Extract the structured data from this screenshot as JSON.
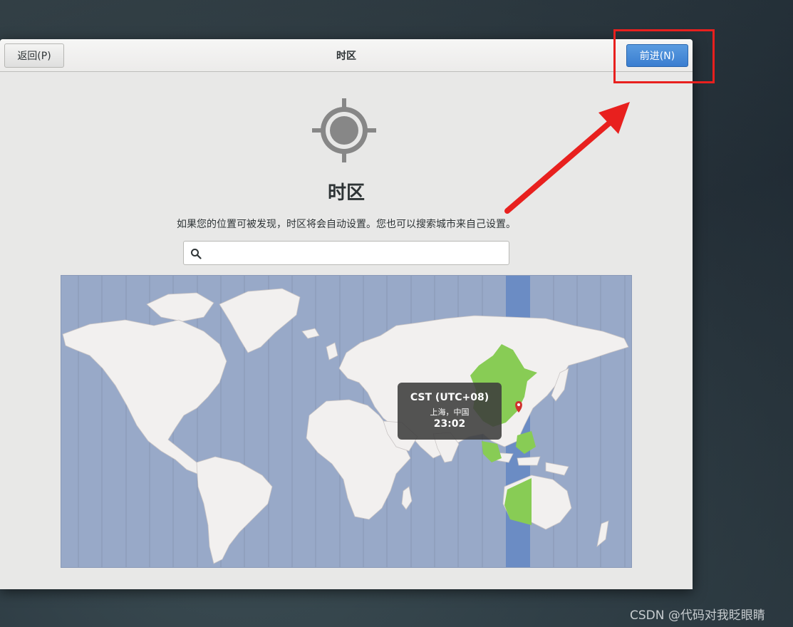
{
  "header": {
    "back_label": "返回(P)",
    "title": "时区",
    "next_label": "前进(N)"
  },
  "main": {
    "icon": "location-target-icon",
    "heading": "时区",
    "description": "如果您的位置可被发现，时区将会自动设置。您也可以搜索城市来自己设置。",
    "search": {
      "value": "",
      "placeholder": "",
      "icon": "search-icon"
    }
  },
  "map": {
    "tooltip": {
      "zone": "CST (UTC+08)",
      "city": "上海，中国",
      "time": "23:02"
    },
    "highlight_color": "#88cc55",
    "ocean_color": "#98a9c8",
    "selected_band_color": "#6b8cc4",
    "pin_color": "#d0312d"
  },
  "annotation": {
    "color": "#e8201e"
  },
  "watermark": "CSDN @代码对我眨眼睛"
}
